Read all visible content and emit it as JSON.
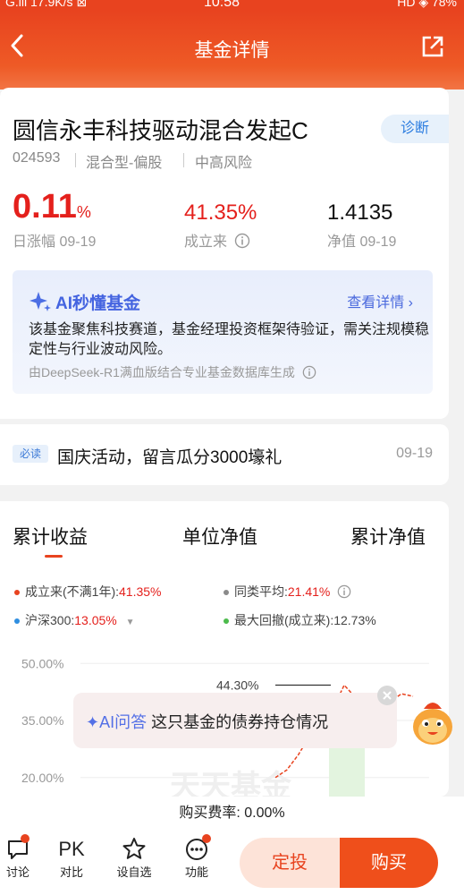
{
  "status_bar": {
    "left": "G.ill  17.9K/s  ⊠",
    "time": "10:58",
    "right": "HD  ◈  78%"
  },
  "header": {
    "title": "基金详情"
  },
  "fund": {
    "name": "圆信永丰科技驱动混合发起C",
    "diagnose_label": "诊断",
    "code": "024593",
    "type": "混合型-偏股",
    "risk": "中高风险",
    "daily_change": "0.11",
    "daily_change_unit": "%",
    "daily_change_label": "日涨幅 09-19",
    "since_inception": "41.35%",
    "since_inception_label": "成立来",
    "nav": "1.4135",
    "nav_label": "净值 09-19"
  },
  "ai_box": {
    "title": "AI秒懂基金",
    "more": "查看详情 ›",
    "text": "该基金聚焦科技赛道，基金经理投资框架待验证，需关注规模稳定性与行业波动风险。",
    "source": "由DeepSeek-R1满血版结合专业基金数据库生成"
  },
  "notice": {
    "tag": "必读",
    "text": "国庆活动，留言瓜分3000壕礼",
    "date": "09-19"
  },
  "chart_tabs": [
    "累计收益",
    "单位净值",
    "累计净值"
  ],
  "legend": {
    "fund_label": "成立来(不满1年):",
    "fund_value": "41.35%",
    "peer_label": "同类平均:",
    "peer_value": "21.41%",
    "index_label": "沪深300:",
    "index_value": "13.05%",
    "drawdown_label": "最大回撤(成立来):",
    "drawdown_value": "12.73%"
  },
  "colors": {
    "brand": "#e8431f",
    "fund_line": "#e8431f",
    "peer_line": "#8a8a8a",
    "index_line": "#2f8ee0",
    "drawdown": "#4cbb4c"
  },
  "chart_data": {
    "type": "line",
    "y_ticks": [
      "50.00%",
      "35.00%",
      "20.00%"
    ],
    "ylim": [
      15,
      55
    ],
    "peak_label": "44.30%",
    "peak_value": 44.3,
    "series": [
      {
        "name": "成立来(不满1年)",
        "values": [
          20,
          22,
          26,
          31,
          35,
          38,
          44.3,
          41,
          37,
          38,
          40,
          42,
          41.35
        ]
      }
    ],
    "watermark": "天天基金"
  },
  "ai_popup": {
    "tag": "✦AI问答",
    "text": "这只基金的债券持仓情况"
  },
  "fee": "购买费率: 0.00%",
  "bottom": {
    "discuss": "讨论",
    "compare_icon": "PK",
    "compare": "对比",
    "watch": "设自选",
    "functions": "功能",
    "dingtou": "定投",
    "buy": "购买"
  }
}
